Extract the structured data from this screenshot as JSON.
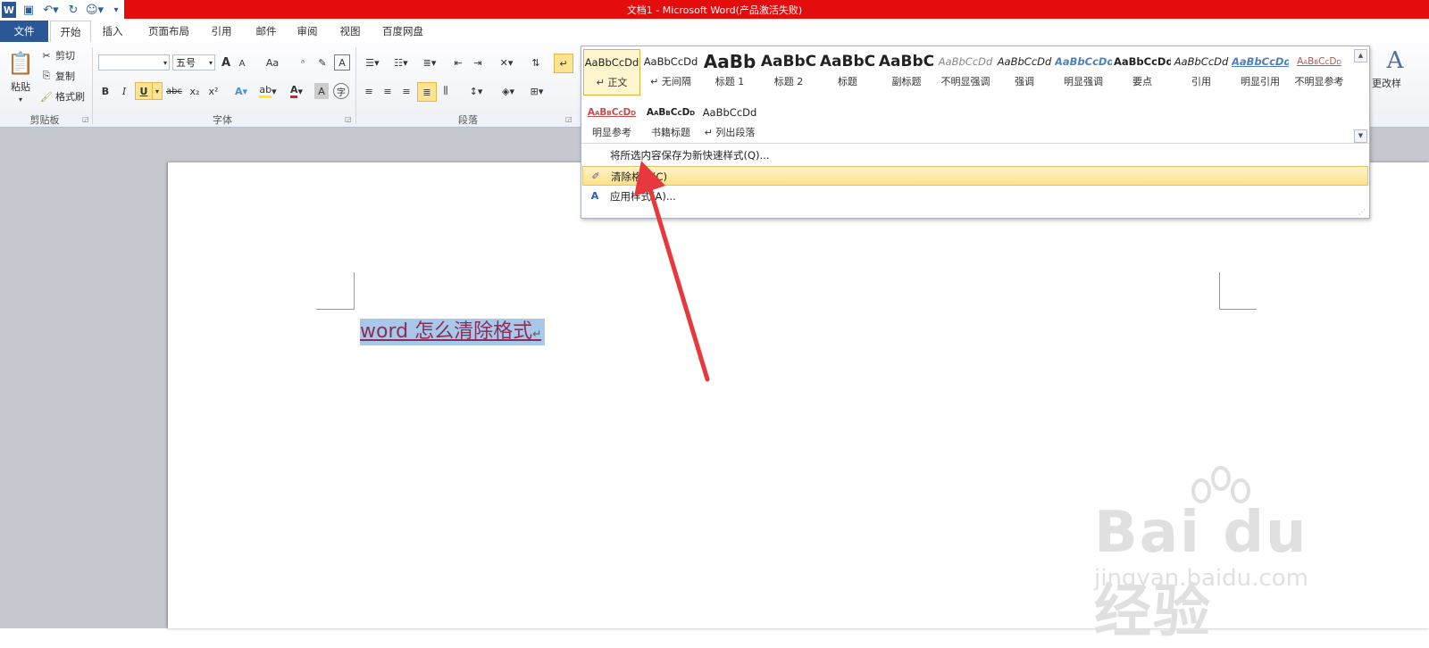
{
  "window": {
    "title": "文档1 - Microsoft Word(产品激活失败)"
  },
  "tabs": [
    {
      "label": "文件"
    },
    {
      "label": "开始"
    },
    {
      "label": "插入"
    },
    {
      "label": "页面布局"
    },
    {
      "label": "引用"
    },
    {
      "label": "邮件"
    },
    {
      "label": "审阅"
    },
    {
      "label": "视图"
    },
    {
      "label": "百度网盘"
    }
  ],
  "clipboard": {
    "paste": "粘贴",
    "cut": "剪切",
    "copy": "复制",
    "format_painter": "格式刷",
    "group": "剪贴板"
  },
  "font": {
    "name_value": "",
    "size_value": "五号",
    "grow": "A",
    "shrink": "A",
    "change_case": "Aa",
    "clear": "A",
    "bold": "B",
    "italic": "I",
    "underline": "U",
    "strike": "abc",
    "subscript": "x₂",
    "superscript": "x²",
    "group": "字体"
  },
  "paragraph": {
    "group": "段落"
  },
  "styles": [
    {
      "sample": "AaBbCcDd",
      "name": "↵ 正文"
    },
    {
      "sample": "AaBbCcDd",
      "name": "↵ 无间隔"
    },
    {
      "sample": "AaBb",
      "name": "标题 1"
    },
    {
      "sample": "AaBbC",
      "name": "标题 2"
    },
    {
      "sample": "AaBbC",
      "name": "标题"
    },
    {
      "sample": "AaBbC",
      "name": "副标题"
    },
    {
      "sample": "AaBbCcDd",
      "name": "不明显强调"
    },
    {
      "sample": "AaBbCcDd",
      "name": "强调"
    },
    {
      "sample": "AaBbCcDd",
      "name": "明显强调"
    },
    {
      "sample": "AaBbCcDd",
      "name": "要点"
    },
    {
      "sample": "AaBbCcDd",
      "name": "引用"
    },
    {
      "sample": "AaBbCcDd",
      "name": "明显引用"
    },
    {
      "sample": "AaBbCcDd",
      "name": "不明显参考"
    },
    {
      "sample": "AaBbCcDd",
      "name": "明显参考"
    },
    {
      "sample": "AaBbCcDd",
      "name": "书籍标题"
    },
    {
      "sample": "AaBbCcDd",
      "name": "↵ 列出段落"
    }
  ],
  "styles_menu": {
    "save_selection": "将所选内容保存为新快速样式(Q)...",
    "clear_formatting": "清除格式(C)",
    "apply_styles": "应用样式(A)..."
  },
  "change_styles": "更改样",
  "document": {
    "text": "word 怎么清除格式"
  },
  "watermark": {
    "brand": "Bai du 经验",
    "url": "jingyan.baidu.com"
  },
  "colors": {
    "title_bar": "#e40d0d",
    "file_tab": "#2b5797",
    "selection": "#a8c8ea",
    "doc_text": "#8a2f5a"
  }
}
